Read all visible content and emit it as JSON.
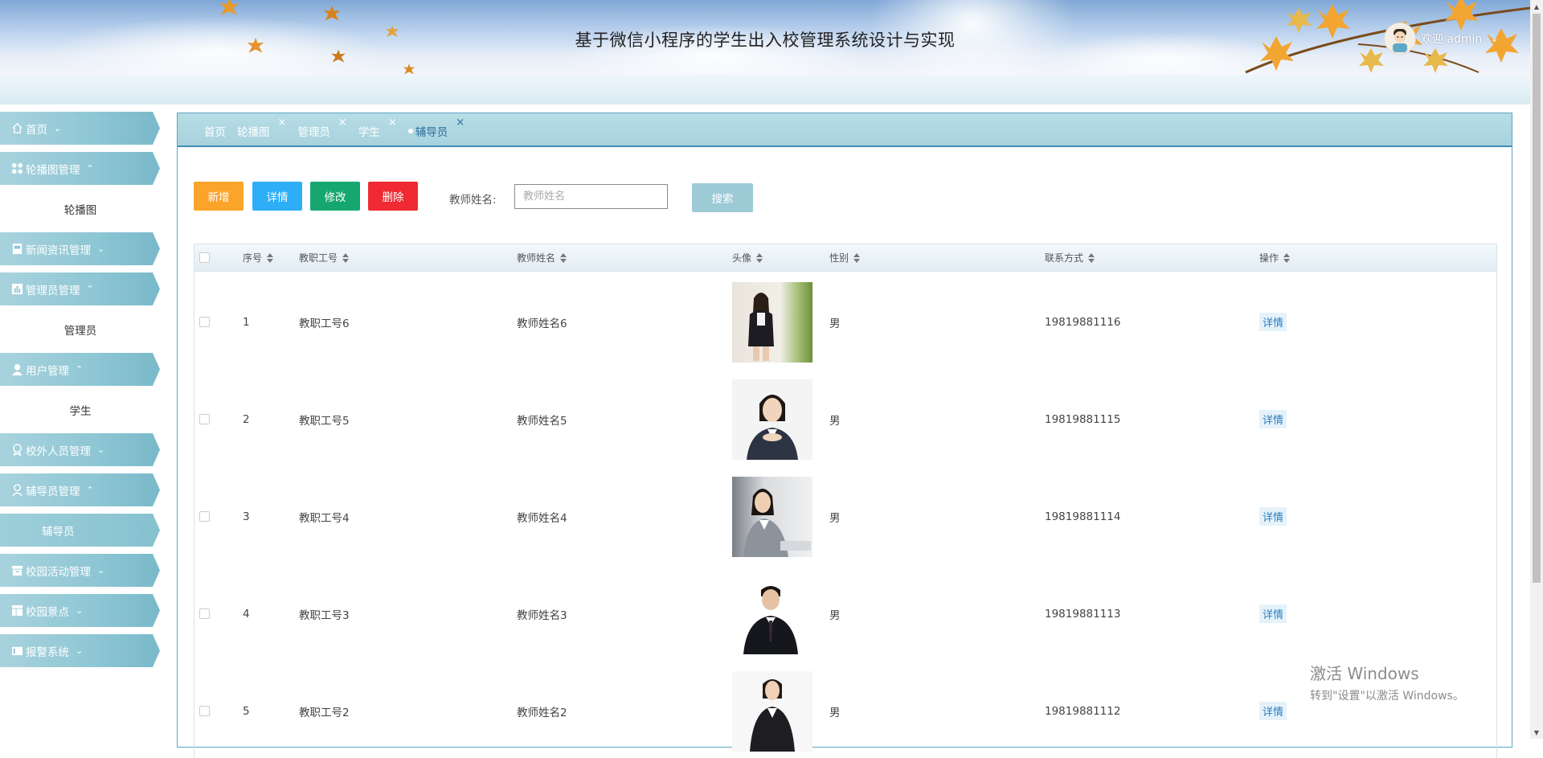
{
  "header": {
    "title": "基于微信小程序的学生出入校管理系统设计与实现",
    "welcome": "欢迎 admin",
    "user_caret": "⌄"
  },
  "sidebar": {
    "menus": [
      {
        "label": "首页",
        "icon": "home-icon",
        "caret": "⌄"
      },
      {
        "label": "轮播图管理",
        "icon": "apps-icon",
        "caret": "⌃"
      },
      {
        "label": "新闻资讯管理",
        "icon": "news-icon",
        "caret": "⌄"
      },
      {
        "label": "管理员管理",
        "icon": "chart-icon",
        "caret": "⌃"
      },
      {
        "label": "用户管理",
        "icon": "user-icon",
        "caret": "⌃"
      },
      {
        "label": "校外人员管理",
        "icon": "badge-icon",
        "caret": "⌄"
      },
      {
        "label": "辅导员管理",
        "icon": "person-icon",
        "caret": "⌃"
      },
      {
        "label": "校园活动管理",
        "icon": "archive-icon",
        "caret": "⌄"
      },
      {
        "label": "校园景点",
        "icon": "layout-icon",
        "caret": "⌄"
      },
      {
        "label": "报警系统",
        "icon": "alarm-icon",
        "caret": "⌄"
      }
    ],
    "subs": {
      "carousel": "轮播图",
      "admin": "管理员",
      "student": "学生",
      "counselor": "辅导员"
    }
  },
  "tabs": [
    {
      "label": "首页",
      "close": ""
    },
    {
      "label": "轮播图",
      "close": "×"
    },
    {
      "label": "管理员",
      "close": "×"
    },
    {
      "label": "学生",
      "close": "×"
    },
    {
      "label": "辅导员",
      "close": "×",
      "active": true
    }
  ],
  "toolbar": {
    "add": "新增",
    "detail": "详情",
    "edit": "修改",
    "delete": "删除",
    "search_label": "教师姓名:",
    "search_placeholder": "教师姓名",
    "search_button": "搜索"
  },
  "table": {
    "headers": [
      "序号",
      "教职工号",
      "教师姓名",
      "头像",
      "性别",
      "联系方式",
      "操作"
    ],
    "rows": [
      {
        "index": "1",
        "staff_id": "教职工号6",
        "name": "教师姓名6",
        "gender": "男",
        "phone": "19819881116",
        "action": "详情"
      },
      {
        "index": "2",
        "staff_id": "教职工号5",
        "name": "教师姓名5",
        "gender": "男",
        "phone": "19819881115",
        "action": "详情"
      },
      {
        "index": "3",
        "staff_id": "教职工号4",
        "name": "教师姓名4",
        "gender": "男",
        "phone": "19819881114",
        "action": "详情"
      },
      {
        "index": "4",
        "staff_id": "教职工号3",
        "name": "教师姓名3",
        "gender": "男",
        "phone": "19819881113",
        "action": "详情"
      },
      {
        "index": "5",
        "staff_id": "教职工号2",
        "name": "教师姓名2",
        "gender": "男",
        "phone": "19819881112",
        "action": "详情"
      }
    ]
  },
  "watermark": {
    "line1": "激活 Windows",
    "line2": "转到\"设置\"以激活 Windows。"
  },
  "colors": {
    "sidebar": "#8ec6d4",
    "tab_bar": "#a7d2de",
    "add": "#fba42a",
    "detail": "#2eaef7",
    "edit": "#16a76f",
    "delete": "#ef2a33",
    "search": "#9ccbd6"
  }
}
